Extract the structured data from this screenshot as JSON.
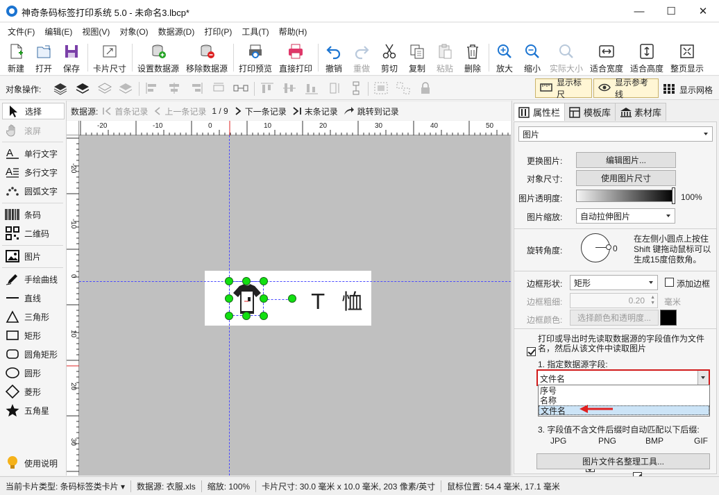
{
  "window": {
    "title": "神奇条码标签打印系统 5.0 - 未命名3.lbcp*",
    "minimize": "—",
    "maximize": "☐",
    "close": "✕"
  },
  "menu": [
    "文件(F)",
    "编辑(E)",
    "视图(V)",
    "对象(O)",
    "数据源(D)",
    "打印(P)",
    "工具(T)",
    "帮助(H)"
  ],
  "toolbar": {
    "new": "新建",
    "open": "打开",
    "save": "保存",
    "card_size": "卡片尺寸",
    "set_datasource": "设置数据源",
    "remove_datasource": "移除数据源",
    "print_preview": "打印预览",
    "direct_print": "直接打印",
    "undo": "撤销",
    "redo": "重做",
    "cut": "剪切",
    "copy": "复制",
    "paste": "粘贴",
    "delete": "删除",
    "zoom_in": "放大",
    "zoom_out": "缩小",
    "actual_size": "实际大小",
    "fit_width": "适合宽度",
    "fit_height": "适合高度",
    "fit_page": "整页显示"
  },
  "opsbar": {
    "label": "对象操作:",
    "show_ruler": "显示标尺",
    "show_guides": "显示参考线",
    "show_grid": "显示网格"
  },
  "tools": {
    "select": "选择",
    "scroll": "滚屏",
    "single_text": "单行文字",
    "multi_text": "多行文字",
    "arc_text": "圆弧文字",
    "barcode": "条码",
    "qrcode": "二维码",
    "image": "图片",
    "freehand": "手绘曲线",
    "line": "直线",
    "triangle": "三角形",
    "rect": "矩形",
    "round_rect": "圆角矩形",
    "circle": "圆形",
    "diamond": "菱形",
    "star": "五角星",
    "help": "使用说明"
  },
  "recnav": {
    "label": "数据源:",
    "first": "首条记录",
    "prev": "上一条记录",
    "counter": "1 / 9",
    "next": "下一条记录",
    "last": "末条记录",
    "jump": "跳转到记录"
  },
  "ruler": {
    "h_labels": [
      "-20",
      "-10",
      "0",
      "10",
      "20",
      "30",
      "40",
      "50"
    ],
    "v_labels": [
      "-20",
      "-10",
      "0",
      "10",
      "20",
      "30"
    ]
  },
  "card": {
    "text": "T  恤"
  },
  "panel": {
    "tabs": [
      "属性栏",
      "模板库",
      "素材库"
    ],
    "object_type": "图片",
    "change_image_label": "更换图片:",
    "edit_image_btn": "编辑图片...",
    "object_size_label": "对象尺寸:",
    "use_image_size_btn": "使用图片尺寸",
    "opacity_label": "图片透明度:",
    "opacity_value": "100%",
    "scale_label": "图片缩放:",
    "scale_value": "自动拉伸图片",
    "rotation_label": "旋转角度:",
    "rotation_value": "0",
    "rotation_hint": "在左侧小圆点上按住Shift 键拖动鼠标可以生成15度倍数角。",
    "border_shape_label": "边框形状:",
    "border_shape_value": "矩形",
    "add_border": "添加边框",
    "border_width_label": "边框粗细:",
    "border_width_value": "0.20",
    "border_width_unit": "毫米",
    "border_color_label": "边框颜色:",
    "border_color_btn": "选择颜色和透明度...",
    "print_read_file": "打印或导出时先读取数据源的字段值作为文件名，然后从该文件中读取图片",
    "step1": "1. 指定数据源字段:",
    "field_value": "文件名",
    "field_options": [
      "序号",
      "名称",
      "文件名"
    ],
    "step3": "3. 字段值不含文件后缀时自动匹配以下后缀:",
    "ext_jpg": "JPG",
    "ext_png": "PNG",
    "ext_bmp": "BMP",
    "ext_gif": "GIF",
    "tidy_btn": "图片文件名整理工具..."
  },
  "status": {
    "card_type": "当前卡片类型: 条码标签类卡片 ▾",
    "datasource": "数据源: 衣服.xls",
    "zoom": "缩放: 100%",
    "card_size": "卡片尺寸: 30.0 毫米 x 10.0 毫米, 203 像素/英寸",
    "mouse_pos": "鼠标位置: 54.4 毫米, 17.1 毫米"
  },
  "colors": {
    "accent": "#1b74d1",
    "handle": "#11e011",
    "guide": "#4a4aff",
    "arrow": "#e02020",
    "highlight_border": "#d11a1a"
  }
}
